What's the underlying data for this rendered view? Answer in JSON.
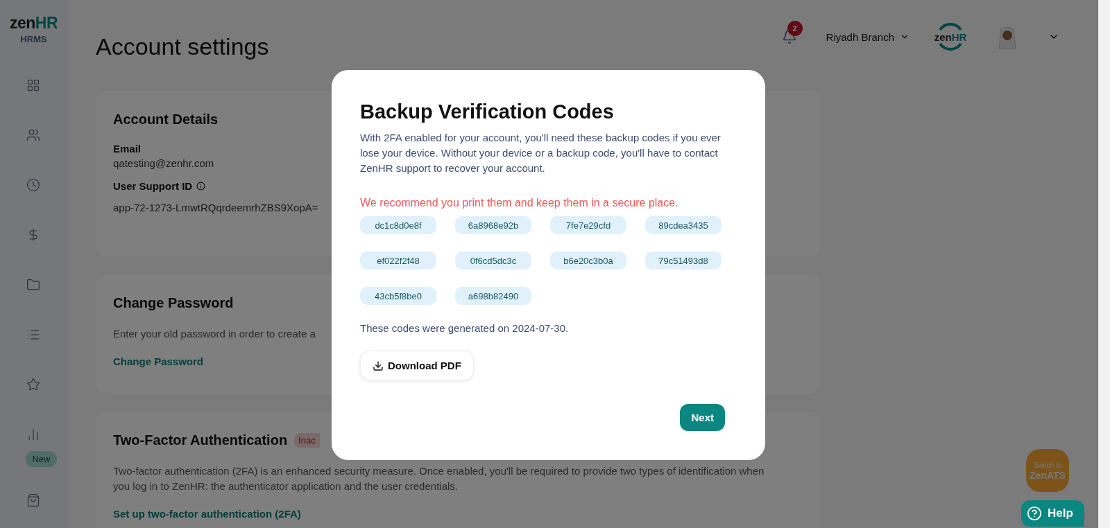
{
  "sidebar": {
    "logo": {
      "brand_left": "zen",
      "brand_right": "HR",
      "product": "HRMS"
    },
    "new_badge": "New"
  },
  "header": {
    "notification_count": "2",
    "branch": "Riyadh Branch",
    "logo": {
      "brand_left": "zen",
      "brand_right": "HR"
    }
  },
  "page_title": "Account settings",
  "account_details": {
    "title": "Account Details",
    "email_label": "Email",
    "email": "qatesting@zenhr.com",
    "support_id_label": "User Support ID",
    "support_id": "app-72-1273-LmwtRQqrdeemrhZBS9XopA="
  },
  "change_password": {
    "title": "Change Password",
    "description": "Enter your old password in order to create a",
    "link": "Change Password"
  },
  "two_factor": {
    "title": "Two-Factor Authentication",
    "status": "Inac",
    "description": "Two-factor authentication (2FA) is an enhanced security measure. Once enabled, you'll be required to provide two types of identification when you log in to ZenHR: the authenticator application and the user credentials.",
    "link": "Set up two-factor authentication (2FA)"
  },
  "modal": {
    "title": "Backup Verification Codes",
    "description": "With 2FA enabled for your account, you'll need these backup codes if you ever lose your device. Without your device or a backup code, you'll have to contact ZenHR support to recover your account.",
    "warning": "We recommend you print them and keep them in a secure place.",
    "codes": [
      "dc1c8d0e8f",
      "6a8968e92b",
      "7fe7e29cfd",
      "89cdea3435",
      "ef022f2f48",
      "0f6cd5dc3c",
      "b6e20c3b0a",
      "79c51493d8",
      "43cb5f8be0",
      "a698b82490"
    ],
    "generated_note": "These codes were generated on 2024-07-30.",
    "download_button": "Download PDF",
    "next_button": "Next"
  },
  "switch_button": {
    "line1": "Switch to",
    "line2": "ZenATS"
  },
  "help_button": "Help"
}
